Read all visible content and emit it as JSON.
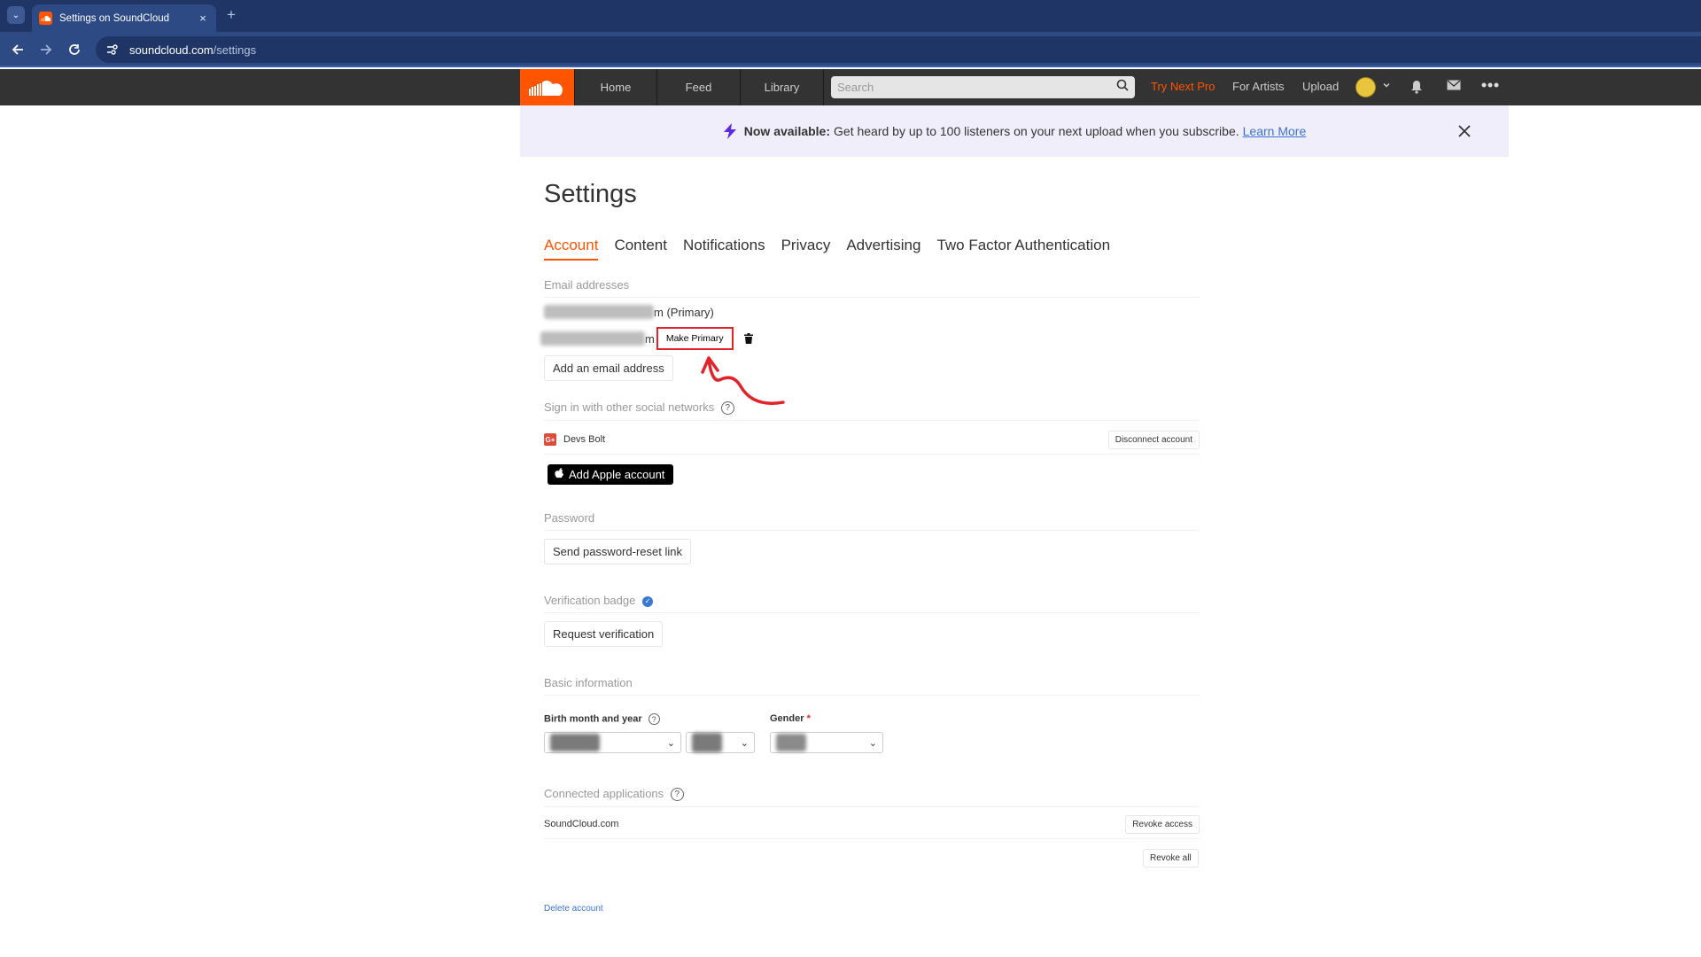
{
  "browser": {
    "tab_title": "Settings on SoundCloud",
    "tab_close": "×",
    "new_tab": "+",
    "url_host": "soundcloud.com",
    "url_path": "/settings"
  },
  "header": {
    "nav": [
      "Home",
      "Feed",
      "Library"
    ],
    "search_placeholder": "Search",
    "try_pro": "Try Next Pro",
    "for_artists": "For Artists",
    "upload": "Upload",
    "accent": "#ff5500"
  },
  "banner": {
    "bold": "Now available:",
    "text": "Get heard by up to 100 listeners on your next upload when you subscribe.",
    "link": "Learn More"
  },
  "settings": {
    "title": "Settings",
    "tabs": [
      "Account",
      "Content",
      "Notifications",
      "Privacy",
      "Advertising",
      "Two Factor Authentication"
    ],
    "active_tab": "Account",
    "email": {
      "label": "Email addresses",
      "primary_suffix": "m (Primary)",
      "secondary_suffix": "m",
      "make_primary": "Make Primary",
      "add_email": "Add an email address"
    },
    "social": {
      "label": "Sign in with other social networks",
      "google_account": "Devs Bolt",
      "disconnect": "Disconnect account",
      "apple": "Add Apple account"
    },
    "password": {
      "label": "Password",
      "reset": "Send password-reset link"
    },
    "verification": {
      "label": "Verification badge",
      "request": "Request verification"
    },
    "basic": {
      "label": "Basic information",
      "birth_label": "Birth month and year",
      "gender_label": "Gender",
      "required_mark": "*"
    },
    "apps": {
      "label": "Connected applications",
      "app_name": "SoundCloud.com",
      "revoke": "Revoke access",
      "revoke_all": "Revoke all"
    },
    "delete_account": "Delete account"
  }
}
